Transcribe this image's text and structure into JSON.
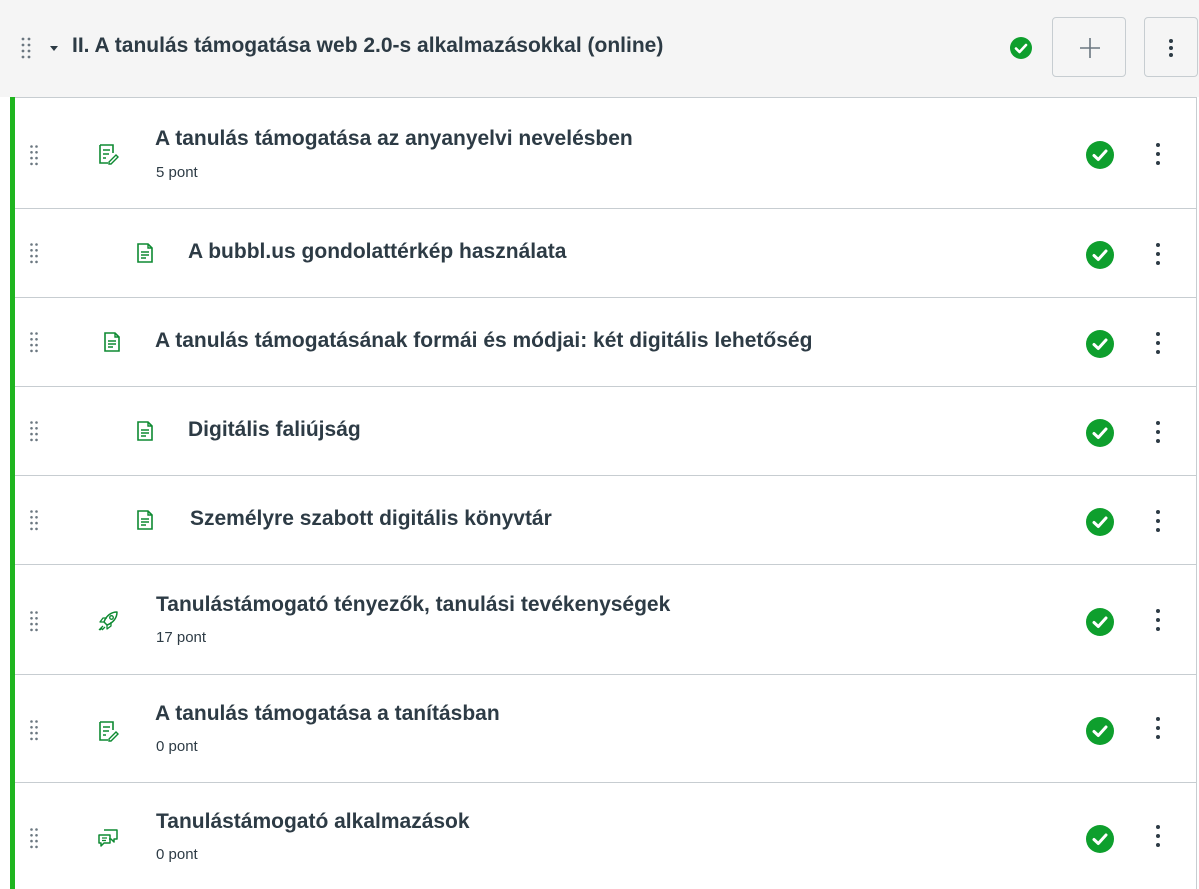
{
  "module": {
    "title": "II. A tanulás támogatása web 2.0-s alkalmazásokkal (online)",
    "published": true,
    "add_button_icon": "plus-icon",
    "menu_button_icon": "vertical-dots-icon"
  },
  "colors": {
    "accent_green": "#1fb51f",
    "check_green": "#0e9f2d",
    "icon_green": "#0e8a32",
    "text": "#2d3b45",
    "border": "#c7cdd1",
    "header_bg": "#f5f5f5"
  },
  "items": [
    {
      "title": "A tanulás támogatása az anyanyelvi nevelésben",
      "points": "5 pont",
      "icon": "assignment-icon",
      "indented": false,
      "published": true
    },
    {
      "title": "A bubbl.us gondolattérkép használata",
      "points": "",
      "icon": "page-icon",
      "indented": true,
      "published": true
    },
    {
      "title": "A tanulás támogatásának formái és módjai: két digitális lehetőség",
      "points": "",
      "icon": "page-icon",
      "indented": false,
      "published": true
    },
    {
      "title": "Digitális faliújság",
      "points": "",
      "icon": "page-icon",
      "indented": true,
      "published": true
    },
    {
      "title": "Személyre szabott digitális könyvtár",
      "points": "",
      "icon": "page-icon",
      "indented": true,
      "published": true
    },
    {
      "title": "Tanulástámogató tényezők, tanulási tevékenységek",
      "points": "17 pont",
      "icon": "quiz-rocket-icon",
      "indented": false,
      "published": true
    },
    {
      "title": "A tanulás támogatása a tanításban",
      "points": "0 pont",
      "icon": "assignment-icon",
      "indented": false,
      "published": true
    },
    {
      "title": "Tanulástámogató alkalmazások",
      "points": "0 pont",
      "icon": "discussion-icon",
      "indented": false,
      "published": true
    }
  ]
}
